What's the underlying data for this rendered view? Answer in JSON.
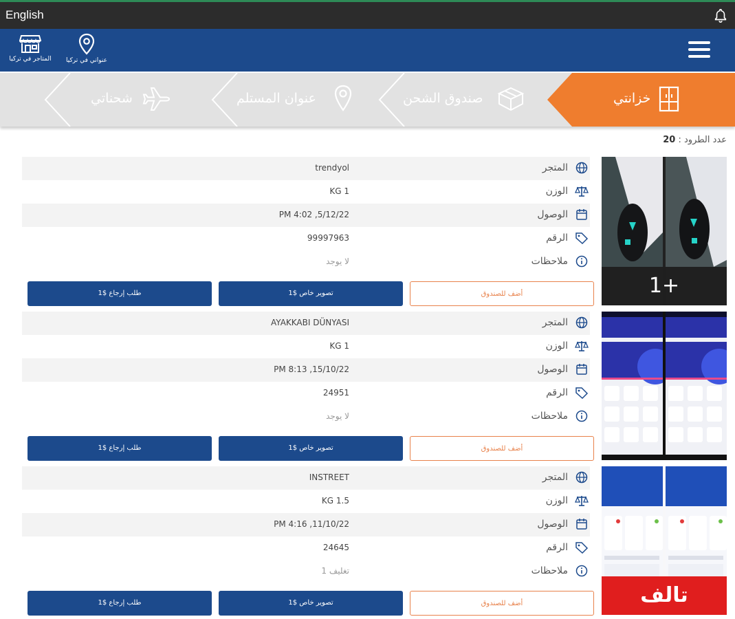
{
  "topbar": {
    "language": "English"
  },
  "header": {
    "address_label": "عنواني في تركيا",
    "stores_label": "المتاجر في تركيا"
  },
  "steps": [
    {
      "label": "خزانتي",
      "icon": "locker-icon",
      "active": true
    },
    {
      "label": "صندوق الشحن",
      "icon": "box-icon",
      "active": false
    },
    {
      "label": "عنوان المستلم",
      "icon": "location-pin-icon",
      "active": false
    },
    {
      "label": "شحناتي",
      "icon": "airplane-icon",
      "active": false
    }
  ],
  "parcel_count": {
    "label": "عدد الطرود :",
    "value": "20"
  },
  "labels": {
    "store": "المتجر",
    "weight": "الوزن",
    "arrival": "الوصول",
    "number": "الرقم",
    "notes": "ملاحظات"
  },
  "buttons": {
    "add_to_box": "أضف للصندوق",
    "special_photo": "تصوير خاص $1",
    "return_request": "طلب إرجاع $1"
  },
  "items": [
    {
      "store": "trendyol",
      "weight": "KG 1",
      "arrival": "PM 4:02 ,5/12/22",
      "number": "99997963",
      "notes": "لا يوجد",
      "photo_overlay": "1+"
    },
    {
      "store": "AYAKKABI DÜNYASI",
      "weight": "KG 1",
      "arrival": "PM 8:13 ,15/10/22",
      "number": "24951",
      "notes": "لا يوجد",
      "photo_overlay": ""
    },
    {
      "store": "INSTREET",
      "weight": "KG 1.5",
      "arrival": "PM 4:16 ,11/10/22",
      "number": "24645",
      "notes": "تغليف 1",
      "photo_overlay": "تالف"
    }
  ],
  "colors": {
    "primary": "#1c4a8c",
    "accent": "#ef7d2e",
    "danger": "#e01e1e"
  }
}
